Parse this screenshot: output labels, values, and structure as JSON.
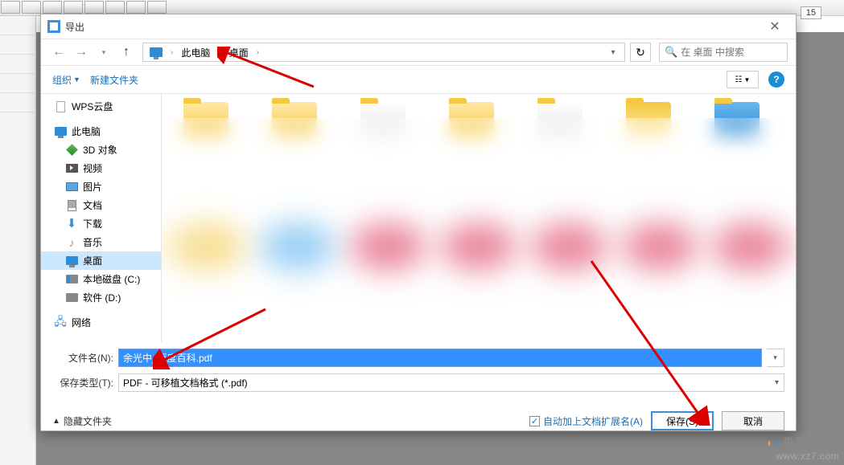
{
  "dialog": {
    "title": "导出"
  },
  "breadcrumb": {
    "items": [
      "此电脑",
      "桌面"
    ]
  },
  "search": {
    "placeholder": "在 桌面 中搜索"
  },
  "commands": {
    "organize": "组织",
    "new_folder": "新建文件夹"
  },
  "tree": {
    "wps_cloud": "WPS云盘",
    "this_pc": "此电脑",
    "objects_3d": "3D 对象",
    "videos": "视频",
    "pictures": "图片",
    "documents": "文档",
    "downloads": "下载",
    "music": "音乐",
    "desktop": "桌面",
    "disk_c": "本地磁盘 (C:)",
    "disk_d": "软件 (D:)",
    "network": "网络"
  },
  "fields": {
    "filename_label": "文件名(N):",
    "filename_value": "余光中_百度百科.pdf",
    "savetype_label": "保存类型(T):",
    "savetype_value": "PDF - 可移植文档格式 (*.pdf)"
  },
  "footer": {
    "hide_folders": "隐藏文件夹",
    "auto_ext": "自动加上文档扩展名(A)",
    "save_btn": "保存(S)",
    "cancel_btn": "取消"
  },
  "page_indicator": "15",
  "watermark": {
    "brand": "极光下载站",
    "url": "www.xz7.com"
  }
}
